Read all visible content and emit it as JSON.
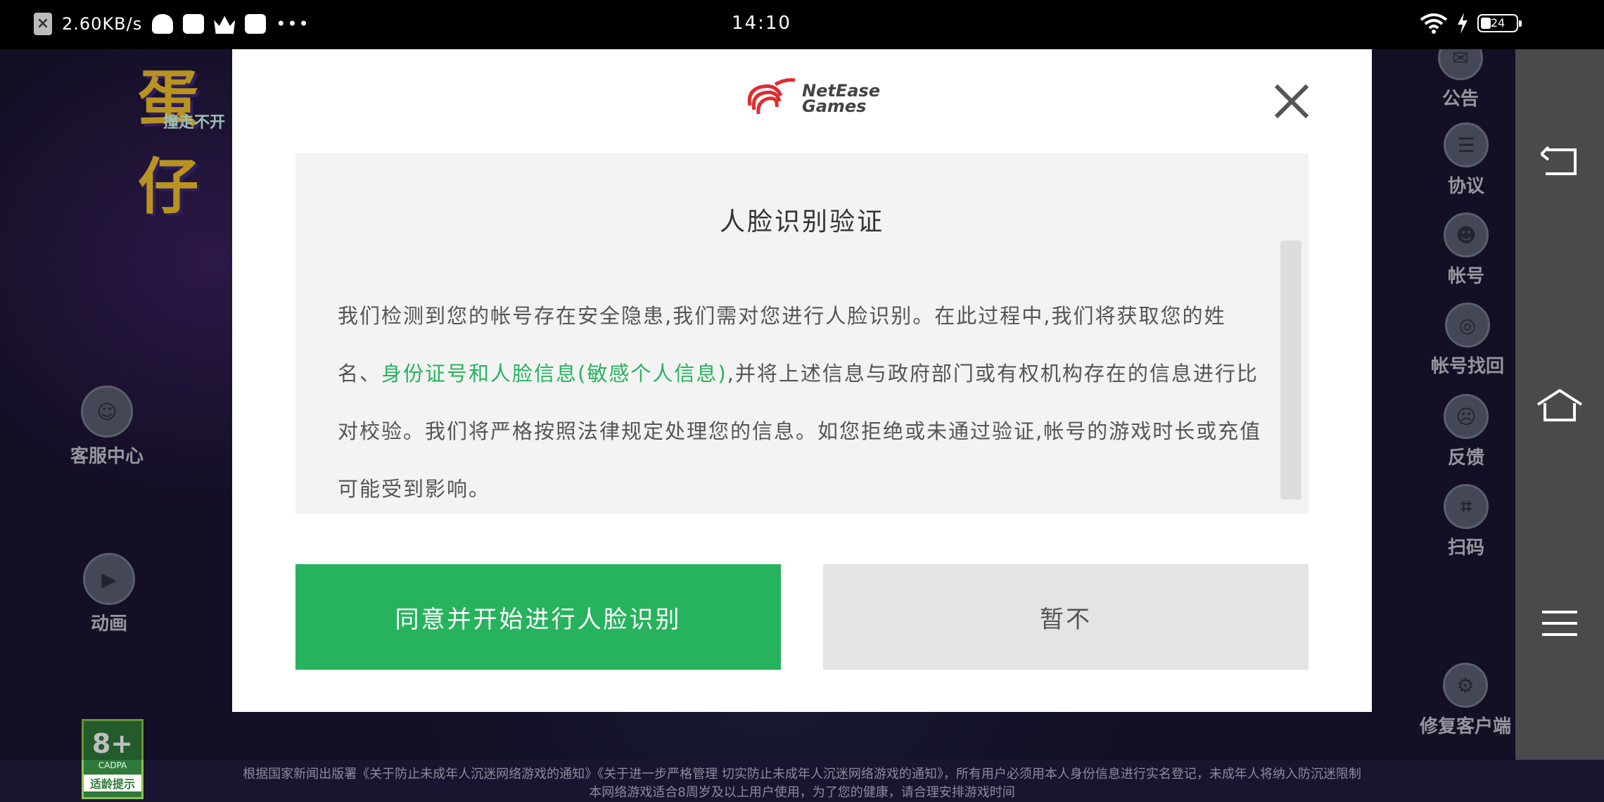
{
  "status_bar": {
    "net_speed": "2.60KB/s",
    "time": "14:10",
    "battery": "24",
    "more": "•••"
  },
  "game": {
    "logo_fragment": "蛋仔",
    "logo_sub": "撞走不开",
    "left_buttons": [
      {
        "label": "客服中心",
        "icon": "headset-icon"
      },
      {
        "label": "动画",
        "icon": "video-icon"
      }
    ],
    "right_buttons": [
      {
        "label": "公告",
        "icon": "announcement-icon"
      },
      {
        "label": "协议",
        "icon": "agreement-icon"
      },
      {
        "label": "帐号",
        "icon": "account-icon"
      },
      {
        "label": "帐号找回",
        "icon": "account-recovery-icon"
      },
      {
        "label": "反馈",
        "icon": "feedback-icon"
      },
      {
        "label": "扫码",
        "icon": "scan-icon"
      },
      {
        "label": "修复客户端",
        "icon": "repair-icon"
      }
    ],
    "rating": {
      "age": "8+",
      "org": "CADPA",
      "tip": "适龄提示"
    },
    "notice_line1": "根据国家新闻出版署《关于防止未成年人沉迷网络游戏的通知》《关于进一步严格管理 切实防止未成年人沉迷网络游戏的通知》，所有用户必须用本人身份信息进行实名登记，未成年人将纳入防沉迷限制",
    "notice_line2": "本网络游戏适合8周岁及以上用户使用，为了您的健康，请合理安排游戏时间"
  },
  "dialog": {
    "brand_line1": "NetEase",
    "brand_line2": "Games",
    "title": "人脸识别验证",
    "text_part1": "我们检测到您的帐号存在安全隐患,我们需对您进行人脸识别。在此过程中,我们将获取您的姓名、",
    "text_highlight": "身份证号和人脸信息(敏感个人信息)",
    "text_part2": ",并将上述信息与政府部门或有权机构存在的信息进行比对校验。我们将严格按照法律规定处理您的信息。如您拒绝或未通过验证,帐号的游戏时长或充值可能受到影响。",
    "agree_label": "同意并开始进行人脸识别",
    "later_label": "暂不"
  },
  "colors": {
    "accent_green": "#27b35e",
    "dialog_bg": "#ffffff",
    "content_bg": "#f3f3f3"
  }
}
